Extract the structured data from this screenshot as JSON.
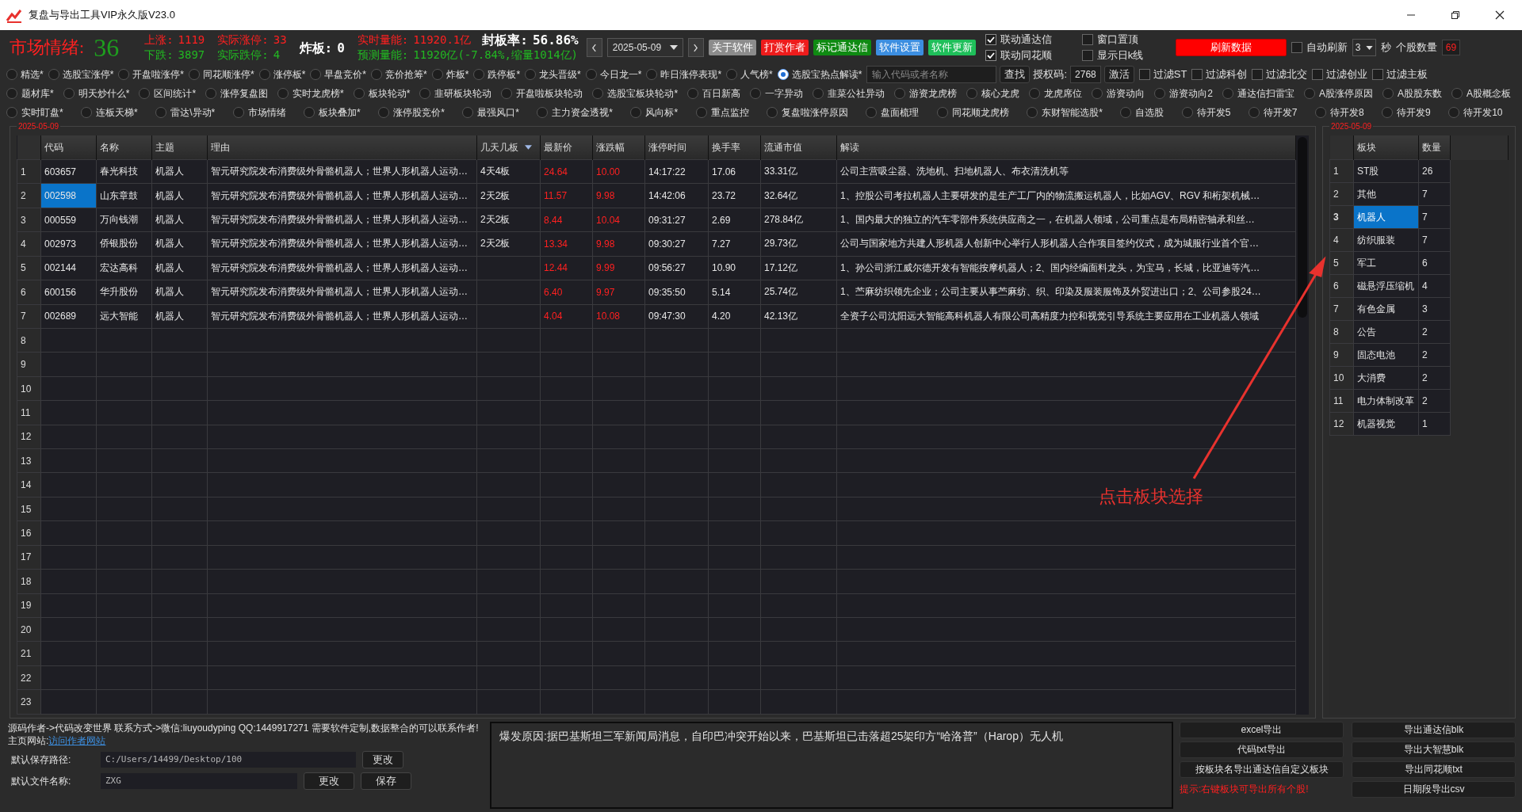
{
  "window": {
    "title": "复盘与导出工具VIP永久版V23.0"
  },
  "market": {
    "mood_label": "市场情绪:",
    "mood_value": "36",
    "stat_columns": [
      {
        "lines": [
          [
            {
              "label": "上涨:",
              "value": "1119",
              "kind": "up"
            }
          ],
          [
            {
              "label": "下跌:",
              "value": "3897",
              "kind": "down"
            }
          ]
        ]
      },
      {
        "lines": [
          [
            {
              "label": "实际涨停:",
              "value": "33",
              "kind": "up"
            }
          ],
          [
            {
              "label": "实际跌停:",
              "value": "4",
              "kind": "down"
            }
          ]
        ]
      },
      {
        "lines": [
          [
            {
              "label": "炸板:",
              "value": "0",
              "kind": "neutral"
            }
          ]
        ]
      },
      {
        "lines": [
          [
            {
              "label": "实时量能:",
              "value": "11920.1亿",
              "kind": "up"
            },
            {
              "label": "封板率:",
              "value": "56.86%",
              "kind": "neutral"
            }
          ],
          [
            {
              "label": "预测量能:",
              "value": "11920亿(-7.84%,缩量1014亿)",
              "kind": "down"
            }
          ]
        ]
      }
    ]
  },
  "date_picker": {
    "value": "2025-05-09"
  },
  "action_buttons": [
    {
      "label": "关于软件",
      "color": "#8c8c8c"
    },
    {
      "label": "打赏作者",
      "color": "#ee1c1c"
    },
    {
      "label": "标记通达信",
      "color": "#0f8a12"
    },
    {
      "label": "软件设置",
      "color": "#3c8ee0"
    },
    {
      "label": "软件更新",
      "color": "#1fbf5a"
    }
  ],
  "link_options": [
    {
      "label": "联动通达信",
      "checked": true
    },
    {
      "label": "联动同花顺",
      "checked": true
    },
    {
      "label": "窗口置顶",
      "checked": false
    },
    {
      "label": "显示日k线",
      "checked": false
    }
  ],
  "refresh_button": "刷新数据",
  "auto_refresh": {
    "label": "自动刷新",
    "checked": false,
    "interval": "3",
    "unit": "秒"
  },
  "stock_count": {
    "label": "个股数量",
    "value": "69"
  },
  "radio_rows": [
    {
      "options": [
        {
          "label": "精选*",
          "selected": false
        },
        {
          "label": "选股宝涨停*",
          "selected": false
        },
        {
          "label": "开盘啦涨停*",
          "selected": false
        },
        {
          "label": "同花顺涨停*",
          "selected": false
        },
        {
          "label": "涨停板*",
          "selected": false
        },
        {
          "label": "早盘竞价*",
          "selected": false
        },
        {
          "label": "竞价抢筹*",
          "selected": false
        },
        {
          "label": "炸板*",
          "selected": false
        },
        {
          "label": "跌停板*",
          "selected": false
        },
        {
          "label": "龙头晋级*",
          "selected": false
        },
        {
          "label": "今日龙一*",
          "selected": false
        },
        {
          "label": "昨日涨停表现*",
          "selected": false
        },
        {
          "label": "人气榜*",
          "selected": false
        },
        {
          "label": "选股宝热点解读*",
          "selected": true
        }
      ]
    },
    {
      "options": [
        {
          "label": "题材库*",
          "selected": false
        },
        {
          "label": "明天炒什么*",
          "selected": false
        },
        {
          "label": "区间统计*",
          "selected": false
        },
        {
          "label": "涨停复盘图",
          "selected": false
        },
        {
          "label": "实时龙虎榜*",
          "selected": false
        },
        {
          "label": "板块轮动*",
          "selected": false
        },
        {
          "label": "韭研板块轮动",
          "selected": false
        },
        {
          "label": "开盘啦板块轮动",
          "selected": false
        },
        {
          "label": "选股宝板块轮动*",
          "selected": false
        },
        {
          "label": "百日新高",
          "selected": false
        },
        {
          "label": "一字异动",
          "selected": false
        },
        {
          "label": "韭菜公社异动",
          "selected": false
        },
        {
          "label": "游资龙虎榜",
          "selected": false
        },
        {
          "label": "核心龙虎",
          "selected": false
        },
        {
          "label": "龙虎席位",
          "selected": false
        },
        {
          "label": "游资动向",
          "selected": false
        },
        {
          "label": "游资动向2",
          "selected": false
        },
        {
          "label": "通达信扫雷宝",
          "selected": false
        },
        {
          "label": "A股涨停原因",
          "selected": false
        },
        {
          "label": "A股股东数",
          "selected": false
        },
        {
          "label": "A股概念板",
          "selected": false
        }
      ]
    },
    {
      "options": [
        {
          "label": "实时盯盘*",
          "selected": false
        },
        {
          "label": "连板天梯*",
          "selected": false
        },
        {
          "label": "雷达\\异动*",
          "selected": false
        },
        {
          "label": "市场情绪",
          "selected": false
        },
        {
          "label": "板块叠加*",
          "selected": false
        },
        {
          "label": "涨停股竞价*",
          "selected": false
        },
        {
          "label": "最强风口*",
          "selected": false
        },
        {
          "label": "主力资金透视*",
          "selected": false
        },
        {
          "label": "风向标*",
          "selected": false
        },
        {
          "label": "重点监控",
          "selected": false
        },
        {
          "label": "复盘啦涨停原因",
          "selected": false
        },
        {
          "label": "盘面梳理",
          "selected": false
        },
        {
          "label": "同花顺龙虎榜",
          "selected": false
        },
        {
          "label": "东财智能选股*",
          "selected": false
        },
        {
          "label": "自选股",
          "selected": false
        },
        {
          "label": "待开发5",
          "selected": false
        },
        {
          "label": "待开发7",
          "selected": false
        },
        {
          "label": "待开发8",
          "selected": false
        },
        {
          "label": "待开发9",
          "selected": false
        },
        {
          "label": "待开发10",
          "selected": false
        }
      ]
    }
  ],
  "quick_search": {
    "placeholder": "输入代码或者名称",
    "button": "查找",
    "auth_label": "授权码:",
    "auth_code": "2768",
    "activate": "激活"
  },
  "filters": [
    {
      "label": "过滤ST",
      "checked": false
    },
    {
      "label": "过滤科创",
      "checked": false
    },
    {
      "label": "过滤北交",
      "checked": false
    },
    {
      "label": "过滤创业",
      "checked": false
    },
    {
      "label": "过滤主板",
      "checked": false
    }
  ],
  "stock_table": {
    "date": "2025-05-09",
    "columns": [
      {
        "label": "代码",
        "kind": "text",
        "sorted": false
      },
      {
        "label": "名称",
        "kind": "text",
        "sorted": false
      },
      {
        "label": "主题",
        "kind": "text",
        "sorted": false
      },
      {
        "label": "理由",
        "kind": "text",
        "sorted": false
      },
      {
        "label": "几天几板",
        "kind": "text",
        "sorted": true
      },
      {
        "label": "最新价",
        "kind": "price",
        "sorted": false
      },
      {
        "label": "涨跌幅",
        "kind": "price",
        "sorted": false
      },
      {
        "label": "涨停时间",
        "kind": "text",
        "sorted": false
      },
      {
        "label": "换手率",
        "kind": "text",
        "sorted": false
      },
      {
        "label": "流通市值",
        "kind": "text",
        "sorted": false
      },
      {
        "label": "解读",
        "kind": "text",
        "sorted": false
      }
    ],
    "rows": [
      {
        "index": "1",
        "selected": false,
        "cells": [
          "603657",
          "春光科技",
          "机器人",
          "智元研究院发布消费级外骨骼机器人；世界人形机器人运动…",
          "4天4板",
          "24.64",
          "10.00",
          "14:17:22",
          "17.06",
          "33.31亿",
          "公司主营吸尘器、洗地机、扫地机器人、布衣清洗机等"
        ]
      },
      {
        "index": "2",
        "selected": true,
        "cells": [
          "002598",
          "山东章鼓",
          "机器人",
          "智元研究院发布消费级外骨骼机器人；世界人形机器人运动…",
          "2天2板",
          "11.57",
          "9.98",
          "14:42:06",
          "23.72",
          "32.64亿",
          "1、控股公司考拉机器人主要研发的是生产工厂内的物流搬运机器人，比如AGV、RGV 和桁架机械…"
        ]
      },
      {
        "index": "3",
        "selected": false,
        "cells": [
          "000559",
          "万向钱潮",
          "机器人",
          "智元研究院发布消费级外骨骼机器人；世界人形机器人运动…",
          "2天2板",
          "8.44",
          "10.04",
          "09:31:27",
          "2.69",
          "278.84亿",
          "1、国内最大的独立的汽车零部件系统供应商之一，在机器人领域，公司重点是布局精密轴承和丝…"
        ]
      },
      {
        "index": "4",
        "selected": false,
        "cells": [
          "002973",
          "侨银股份",
          "机器人",
          "智元研究院发布消费级外骨骼机器人；世界人形机器人运动…",
          "2天2板",
          "13.34",
          "9.98",
          "09:30:27",
          "7.27",
          "29.73亿",
          "公司与国家地方共建人形机器人创新中心举行人形机器人合作项目签约仪式，成为城服行业首个官…"
        ]
      },
      {
        "index": "5",
        "selected": false,
        "cells": [
          "002144",
          "宏达高科",
          "机器人",
          "智元研究院发布消费级外骨骼机器人；世界人形机器人运动…",
          null,
          "12.44",
          "9.99",
          "09:56:27",
          "10.90",
          "17.12亿",
          "1、孙公司浙江威尔德开发有智能按摩机器人；2、国内经编面料龙头，为宝马，长城，比亚迪等汽…"
        ]
      },
      {
        "index": "6",
        "selected": false,
        "cells": [
          "600156",
          "华升股份",
          "机器人",
          "智元研究院发布消费级外骨骼机器人；世界人形机器人运动…",
          null,
          "6.40",
          "9.97",
          "09:35:50",
          "5.14",
          "25.74亿",
          "1、苎麻纺织领先企业；公司主要从事苎麻纺、织、印染及服装服饰及外贸进出口；2、公司参股24…"
        ]
      },
      {
        "index": "7",
        "selected": false,
        "cells": [
          "002689",
          "远大智能",
          "机器人",
          "智元研究院发布消费级外骨骼机器人；世界人形机器人运动…",
          null,
          "4.04",
          "10.08",
          "09:47:30",
          "4.20",
          "42.13亿",
          "全资子公司沈阳远大智能高科机器人有限公司高精度力控和视觉引导系统主要应用在工业机器人领域"
        ]
      }
    ],
    "blank_rows": [
      "8",
      "9",
      "10",
      "11",
      "12",
      "13",
      "14",
      "15",
      "16",
      "17",
      "18",
      "19",
      "20",
      "21",
      "22",
      "23"
    ]
  },
  "sector_table": {
    "date": "2025-05-09",
    "columns": [
      "板块",
      "数量"
    ],
    "rows": [
      {
        "index": "1",
        "name": "ST股",
        "count": "26",
        "selected": false
      },
      {
        "index": "2",
        "name": "其他",
        "count": "7",
        "selected": false
      },
      {
        "index": "3",
        "name": "机器人",
        "count": "7",
        "selected": true
      },
      {
        "index": "4",
        "name": "纺织服装",
        "count": "7",
        "selected": false
      },
      {
        "index": "5",
        "name": "军工",
        "count": "6",
        "selected": false
      },
      {
        "index": "6",
        "name": "磁悬浮压缩机",
        "count": "4",
        "selected": false
      },
      {
        "index": "7",
        "name": "有色金属",
        "count": "3",
        "selected": false
      },
      {
        "index": "8",
        "name": "公告",
        "count": "2",
        "selected": false
      },
      {
        "index": "9",
        "name": "固态电池",
        "count": "2",
        "selected": false
      },
      {
        "index": "10",
        "name": "大消费",
        "count": "2",
        "selected": false
      },
      {
        "index": "11",
        "name": "电力体制改革",
        "count": "2",
        "selected": false
      },
      {
        "index": "12",
        "name": "机器视觉",
        "count": "1",
        "selected": false
      }
    ]
  },
  "annotation": {
    "text": "点击板块选择"
  },
  "credits": {
    "text": "源码作者->代码改变世界 联系方式->微信:liuyoudyping QQ:1449917271 需要软件定制,数据整合的可以联系作者! 主页网站:",
    "link": "访问作者网站"
  },
  "save_path": {
    "label": "默认保存路径:",
    "value": "C:/Users/14499/Desktop/100",
    "button": "更改"
  },
  "file_name": {
    "label": "默认文件名称:",
    "value": "ZXG",
    "buttons": [
      "更改",
      "保存"
    ]
  },
  "reason": "爆发原因:据巴基斯坦三军新闻局消息，自印巴冲突开始以来，巴基斯坦已击落超25架印方“哈洛普”（Harop）无人机",
  "export_items": [
    {
      "kind": "button",
      "label": "excel导出"
    },
    {
      "kind": "button",
      "label": "导出通达信blk"
    },
    {
      "kind": "button",
      "label": "代码txt导出"
    },
    {
      "kind": "button",
      "label": "导出大智慧blk"
    },
    {
      "kind": "button",
      "label": "按板块名导出通达信自定义板块"
    },
    {
      "kind": "button",
      "label": "导出同花顺txt"
    },
    {
      "kind": "hint",
      "label": "提示:右键板块可导出所有个股!"
    },
    {
      "kind": "button",
      "label": "日期段导出csv"
    }
  ]
}
